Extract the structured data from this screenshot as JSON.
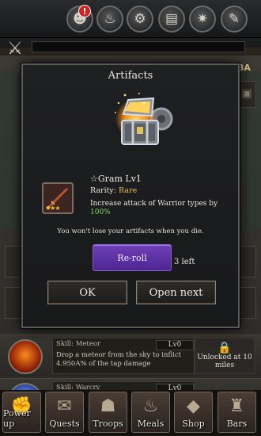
{
  "modal": {
    "title": "Artifacts",
    "item_name": "☆Gram Lv1",
    "rarity_label": "Rarity:",
    "rarity_value": "Rare",
    "desc_text": "Increase attack of Warrior types by",
    "desc_value": "100%",
    "stars": "★★★",
    "note": "You won't lose your artifacts when you die.",
    "reroll_label": "Re-roll",
    "reroll_left": "3 left",
    "ok_label": "OK",
    "open_next_label": "Open next"
  },
  "topbar": {
    "notification": "!",
    "edge_tag": "BA",
    "icons": [
      "hero-icon",
      "fire-icon",
      "gear-icon",
      "book-icon",
      "cog-icon",
      "wrench-icon"
    ]
  },
  "skills": [
    {
      "name": "Skill: Meteor",
      "level": "Lv0",
      "desc": "Drop a meteor from the sky to inflict 4.950A% of the tap damage",
      "unlock": "Unlocked at 10 miles"
    },
    {
      "name": "Skill: Warcry",
      "level": "Lv0"
    }
  ],
  "nav": {
    "items": [
      "Power up",
      "Quests",
      "Troops",
      "Meals",
      "Shop",
      "Bars"
    ]
  },
  "colors": {
    "accent_purple": "#5b30a6",
    "rarity_gold": "#e9c24b",
    "value_green": "#7bd36b",
    "notif_red": "#d32222"
  }
}
